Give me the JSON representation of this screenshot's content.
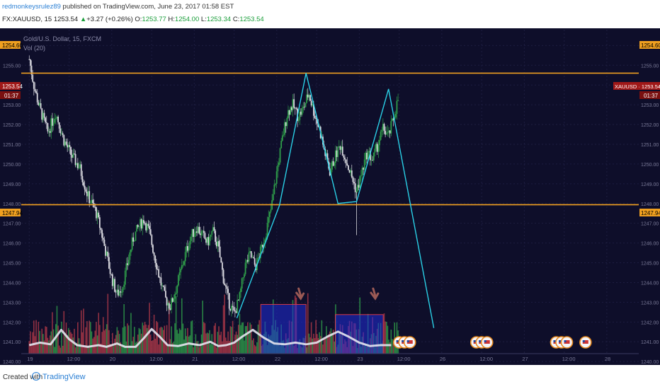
{
  "header": {
    "author": "redmonkeysrulez89",
    "publish_text": "published on TradingView.com, June 23, 2017 01:58 EST",
    "symbol": "FX:XAUUSD, 15",
    "last": "1253.54",
    "change_arrow": "▲",
    "change": "+3.27 (+0.26%)",
    "o_label": "O:",
    "o_value": "1253.77",
    "h_label": "H:",
    "h_value": "1254.00",
    "l_label": "L:",
    "l_value": "1253.34",
    "c_label": "C:",
    "c_value": "1253.54"
  },
  "legend": {
    "title": "Gold/U.S. Dollar, 15, FXCM",
    "indicator": "Vol (20)"
  },
  "badges": {
    "left_top": "1254.60",
    "left_price": "1253.54",
    "left_time": "01:37",
    "left_bottom": "1247.94",
    "right_top": "1254.60",
    "right_price": "XAUUSD · 1253.54",
    "right_time": "01:37",
    "right_bottom": "1247.94"
  },
  "footer": {
    "created": "Created with",
    "brand": "TradingView"
  },
  "colors": {
    "background": "#0e0e2a",
    "level_line": "#f0a020",
    "pattern_line": "#2ad0e6",
    "volume_ma": "#e6e6f0",
    "annotation_arrow": "#9b5a55",
    "bull": "#2f9e4a",
    "bear": "#b23a48",
    "box_fill": "#1f2bd8",
    "box_border": "#d83a4a",
    "price_badge": "#a01818"
  },
  "chart_data": {
    "type": "candlestick",
    "ylim": [
      1240.4,
      1256.8
    ],
    "y_ticks": [
      "1256.00",
      "1255.00",
      "1254.00",
      "1253.00",
      "1252.00",
      "1251.00",
      "1250.00",
      "1249.00",
      "1248.00",
      "1247.00",
      "1246.00",
      "1245.00",
      "1244.00",
      "1243.00",
      "1242.00",
      "1241.00",
      "1240.00"
    ],
    "x_ticks": [
      {
        "label": "19",
        "t": 0.0
      },
      {
        "label": "12:00",
        "t": 0.15
      },
      {
        "label": "20",
        "t": 0.31
      },
      {
        "label": "12:00",
        "t": 0.46
      },
      {
        "label": "21",
        "t": 0.62
      },
      {
        "label": "12:00",
        "t": 0.77
      },
      {
        "label": "22",
        "t": 0.93
      },
      {
        "label": "12:00",
        "t": 1.08
      },
      {
        "label": "23",
        "t": 1.24
      },
      {
        "label": "12:00",
        "t": 1.39
      },
      {
        "label": "26",
        "t": 1.55
      },
      {
        "label": "12:00",
        "t": 1.7
      },
      {
        "label": "27",
        "t": 1.86
      },
      {
        "label": "12:00",
        "t": 2.01
      },
      {
        "label": "28",
        "t": 2.17
      }
    ],
    "x_range": [
      -0.03,
      2.29
    ],
    "price_path": [
      [
        0.0,
        1255.3
      ],
      [
        0.02,
        1253.8
      ],
      [
        0.04,
        1252.8
      ],
      [
        0.07,
        1251.6
      ],
      [
        0.1,
        1252.6
      ],
      [
        0.13,
        1251.2
      ],
      [
        0.16,
        1250.4
      ],
      [
        0.19,
        1249.8
      ],
      [
        0.22,
        1248.4
      ],
      [
        0.25,
        1247.6
      ],
      [
        0.27,
        1246.6
      ],
      [
        0.29,
        1245.4
      ],
      [
        0.31,
        1244.2
      ],
      [
        0.33,
        1243.4
      ],
      [
        0.35,
        1243.8
      ],
      [
        0.37,
        1245.0
      ],
      [
        0.39,
        1246.2
      ],
      [
        0.41,
        1246.8
      ],
      [
        0.43,
        1247.2
      ],
      [
        0.45,
        1246.6
      ],
      [
        0.47,
        1245.4
      ],
      [
        0.49,
        1244.2
      ],
      [
        0.51,
        1243.2
      ],
      [
        0.53,
        1242.8
      ],
      [
        0.55,
        1243.6
      ],
      [
        0.57,
        1244.6
      ],
      [
        0.59,
        1245.6
      ],
      [
        0.61,
        1246.4
      ],
      [
        0.63,
        1246.8
      ],
      [
        0.65,
        1246.4
      ],
      [
        0.67,
        1246.0
      ],
      [
        0.69,
        1246.6
      ],
      [
        0.71,
        1245.8
      ],
      [
        0.73,
        1244.2
      ],
      [
        0.75,
        1243.0
      ],
      [
        0.77,
        1242.4
      ],
      [
        0.79,
        1243.2
      ],
      [
        0.81,
        1244.8
      ],
      [
        0.83,
        1245.4
      ],
      [
        0.85,
        1244.8
      ],
      [
        0.87,
        1245.6
      ],
      [
        0.89,
        1246.6
      ],
      [
        0.91,
        1247.8
      ],
      [
        0.93,
        1249.6
      ],
      [
        0.95,
        1251.2
      ],
      [
        0.97,
        1252.6
      ],
      [
        0.99,
        1253.0
      ],
      [
        1.01,
        1252.4
      ],
      [
        1.03,
        1252.8
      ],
      [
        1.05,
        1253.6
      ],
      [
        1.07,
        1252.6
      ],
      [
        1.09,
        1251.8
      ],
      [
        1.11,
        1250.6
      ],
      [
        1.13,
        1249.6
      ],
      [
        1.15,
        1250.4
      ],
      [
        1.17,
        1251.0
      ],
      [
        1.19,
        1250.2
      ],
      [
        1.21,
        1249.4
      ],
      [
        1.23,
        1248.6
      ],
      [
        1.25,
        1249.6
      ],
      [
        1.27,
        1250.6
      ],
      [
        1.29,
        1250.2
      ],
      [
        1.31,
        1251.0
      ],
      [
        1.33,
        1251.8
      ],
      [
        1.35,
        1251.4
      ],
      [
        1.37,
        1252.4
      ],
      [
        1.39,
        1253.5
      ]
    ],
    "levels": [
      1254.6,
      1247.94
    ],
    "pattern": [
      [
        0.78,
        1242.2
      ],
      [
        0.94,
        1247.9
      ],
      [
        1.04,
        1254.6
      ],
      [
        1.16,
        1248.0
      ],
      [
        1.23,
        1248.1
      ],
      [
        1.35,
        1253.8
      ],
      [
        1.52,
        1241.7
      ]
    ],
    "volume_ma": [
      [
        0.0,
        0.1
      ],
      [
        0.04,
        0.13
      ],
      [
        0.08,
        0.11
      ],
      [
        0.12,
        0.28
      ],
      [
        0.15,
        0.17
      ],
      [
        0.18,
        0.1
      ],
      [
        0.22,
        0.08
      ],
      [
        0.26,
        0.1
      ],
      [
        0.29,
        0.08
      ],
      [
        0.33,
        0.12
      ],
      [
        0.36,
        0.08
      ],
      [
        0.4,
        0.08
      ],
      [
        0.43,
        0.18
      ],
      [
        0.46,
        0.29
      ],
      [
        0.49,
        0.2
      ],
      [
        0.52,
        0.1
      ],
      [
        0.56,
        0.09
      ],
      [
        0.6,
        0.12
      ],
      [
        0.64,
        0.1
      ],
      [
        0.68,
        0.14
      ],
      [
        0.71,
        0.09
      ],
      [
        0.74,
        0.1
      ],
      [
        0.77,
        0.13
      ],
      [
        0.8,
        0.2
      ],
      [
        0.84,
        0.28
      ],
      [
        0.88,
        0.19
      ],
      [
        0.92,
        0.12
      ],
      [
        0.96,
        0.11
      ],
      [
        1.0,
        0.13
      ],
      [
        1.04,
        0.11
      ],
      [
        1.08,
        0.13
      ],
      [
        1.12,
        0.2
      ],
      [
        1.16,
        0.26
      ],
      [
        1.2,
        0.2
      ],
      [
        1.24,
        0.13
      ],
      [
        1.28,
        0.09
      ],
      [
        1.32,
        0.1
      ],
      [
        1.36,
        0.1
      ]
    ],
    "boxes": [
      {
        "t0": 0.87,
        "t1": 1.04,
        "h": 0.58
      },
      {
        "t0": 1.15,
        "t1": 1.33,
        "h": 0.46
      }
    ],
    "arrows": [
      1.02,
      1.3
    ],
    "events": [
      1.39,
      1.41,
      1.43,
      1.68,
      1.7,
      1.72,
      1.98,
      2.0,
      2.02,
      2.09
    ]
  }
}
